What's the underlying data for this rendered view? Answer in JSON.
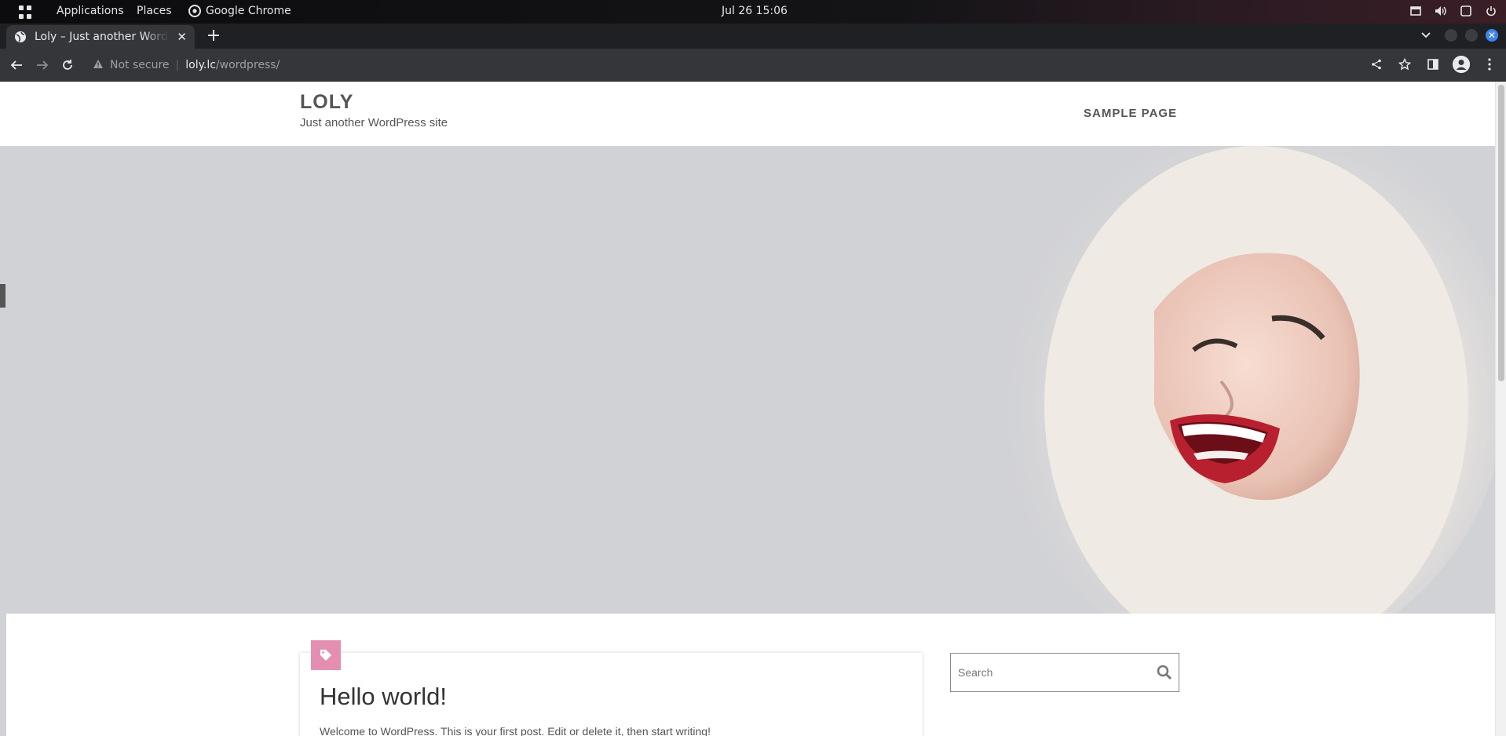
{
  "topbar": {
    "applications": "Applications",
    "places": "Places",
    "app_name": "Google Chrome",
    "datetime": "Jul 26  15:06"
  },
  "tab": {
    "title": "Loly – Just another WordPress site"
  },
  "toolbar": {
    "security_label": "Not secure",
    "url_host": "loly.lc",
    "url_path": "/wordpress/"
  },
  "site": {
    "title": "LOLY",
    "description": "Just another WordPress site",
    "nav": [
      "SAMPLE PAGE"
    ]
  },
  "post": {
    "title": "Hello world!",
    "excerpt": "Welcome to WordPress. This is your first post. Edit or delete it, then start writing!"
  },
  "search": {
    "placeholder": "Search"
  },
  "colors": {
    "hero_bg": "#d1d2d6",
    "tag_accent": "#e48fb2"
  }
}
